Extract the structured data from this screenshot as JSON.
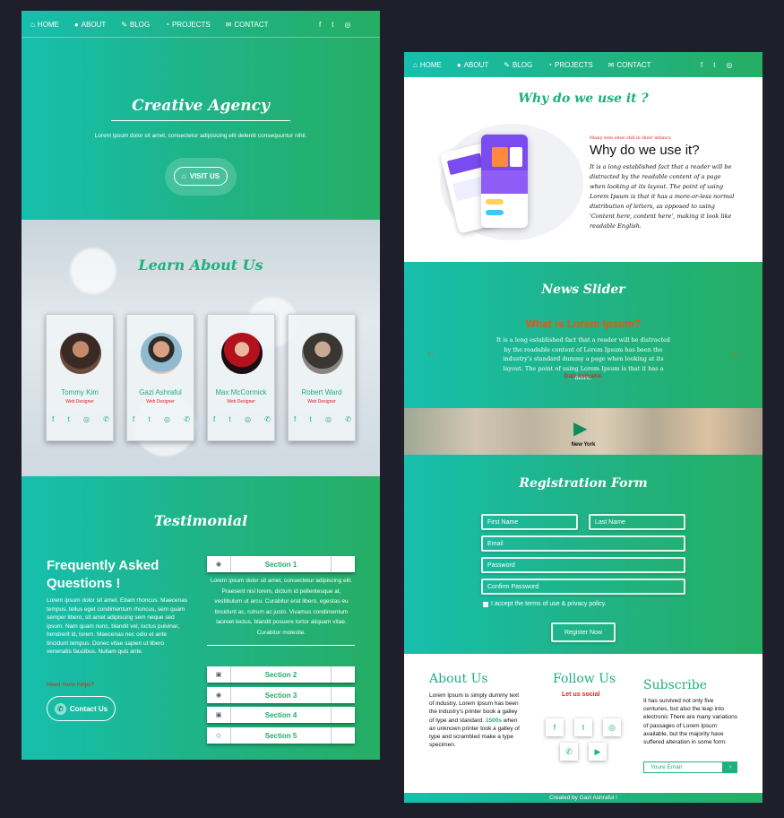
{
  "nav": {
    "items": [
      {
        "icon": "home-icon",
        "glyph": "⌂",
        "label": "HOME"
      },
      {
        "icon": "user-icon",
        "glyph": "●",
        "label": "ABOUT"
      },
      {
        "icon": "pencil-icon",
        "glyph": "✎",
        "label": "BLOG"
      },
      {
        "icon": "pie-chart-icon",
        "glyph": "◔",
        "label": "PROJECTS"
      },
      {
        "icon": "envelope-icon",
        "glyph": "✉",
        "label": "CONTACT"
      }
    ],
    "social": [
      {
        "icon": "facebook-icon",
        "glyph": "f"
      },
      {
        "icon": "twitter-icon",
        "glyph": "t"
      },
      {
        "icon": "instagram-icon",
        "glyph": "◎"
      }
    ]
  },
  "hero": {
    "title": "Creative Agency",
    "subtitle": "Lorem ipsum dolor sit amet, consectetur adipisicing elit deleniti consequuntur nihil.",
    "button": "VISIT US"
  },
  "learn": {
    "title": "Learn About Us",
    "team": [
      {
        "name": "Tommy Kim",
        "role": "Web Designer"
      },
      {
        "name": "Gazi Ashraful",
        "role": "Web Designer"
      },
      {
        "name": "Max McCormick",
        "role": "Web Designer"
      },
      {
        "name": "Robert Ward",
        "role": "Web Designer"
      }
    ]
  },
  "testimonial": {
    "title": "Testimonial",
    "faq_title": "Frequently Asked Questions !",
    "faq_body": "Lorem ipsum dolor sit amet. Etiam rhoncus. Maecenas tempus, tellus eget condimentum rhoncus, sem quam semper libero, sit amet adipiscing sem neque sed ipsum. Nam quam nunc, blandit vel, luctus pulvinar, hendrerit id, lorem. Maecenas nec odio et ante tincidunt tempus. Donec vitae sapien ut libero venenatis faucibus. Nullam quis ante.",
    "need_help": "Need more helps?",
    "contact_button": "Contact Us",
    "sections": [
      {
        "label": "Section 1",
        "icon": "globe-icon",
        "glyph": "◉"
      },
      {
        "label": "Section 2",
        "icon": "address-book-icon",
        "glyph": "▣"
      },
      {
        "label": "Section 3",
        "icon": "eye-icon",
        "glyph": "◉"
      },
      {
        "label": "Section 4",
        "icon": "contact-card-icon",
        "glyph": "▣"
      },
      {
        "label": "Section 5",
        "icon": "diamond-icon",
        "glyph": "◇"
      }
    ],
    "section1_body": "Lorem ipsum dolor sit amet, consectetur adipiscing elit. Praesent nisl lorem, dictum id pellentesque at, vestibulum ut arcu. Curabitur erat libero, egestas eu tincidunt ac, rutrum ac justo. Vivamus condimentum laoreet lectus, blandit posuere tortor aliquam vitae. Curabitur molestie."
  },
  "why": {
    "heading": "Why do we use it ?",
    "small": "Many web sites still in their infancy.",
    "title": "Why do we use it?",
    "body": "It is a long established fact that a reader will be distracted by the readable content of a page when looking at its layout. The point of using Lorem Ipsum is that it has a more-or-less normal distribution of letters, as opposed to using 'Content here, content here', making it look like readable English."
  },
  "news": {
    "title": "News Slider",
    "headline": "What is Lorem Ipsum?",
    "body": "It is a long established fact that a reader will be distracted by the readable content of Lorem Ipsum has been the industry's standard dummy a page when looking at its layout. The point of using Lorem Ipsum is that it has a more.",
    "author": "Gazi Ashraful."
  },
  "video": {
    "caption": "New York"
  },
  "registration": {
    "title": "Registration Form",
    "first_name": "First Name",
    "last_name": "Last Name",
    "email": "Email",
    "password": "Password",
    "confirm": "Confirm Password",
    "terms": "I accept the terms of use & privacy policy.",
    "button": "Register Now"
  },
  "footer": {
    "about_title": "About Us",
    "about_body_1": "Lorem Ipsum is simply dummy text of industry. Lorem Ipsum has been the industry's printer book a galley of type and standard.",
    "about_highlight": "1500s",
    "about_body_2": " when an unknown printer took a galley of type and scrambled make a type specimen.",
    "follow_title": "Follow Us",
    "follow_sub": "Let us social",
    "social": [
      {
        "icon": "facebook-icon",
        "glyph": "f"
      },
      {
        "icon": "twitter-icon",
        "glyph": "t"
      },
      {
        "icon": "instagram-icon",
        "glyph": "◎"
      },
      {
        "icon": "whatsapp-icon",
        "glyph": "✆"
      },
      {
        "icon": "youtube-icon",
        "glyph": "▶"
      }
    ],
    "subscribe_title": "Subscribe",
    "subscribe_body": "It has survived not only five centuries, but also the leap into electronic There are many variations of passages of Lorem Ipsum available, but the majority have suffered alteration in some form.",
    "email_placeholder": "Youre Email",
    "credit": "Created by Gazi Ashraful !"
  },
  "colors": {
    "accent": "#1fb07c",
    "red": "#e02020",
    "orange": "#e05a10"
  }
}
